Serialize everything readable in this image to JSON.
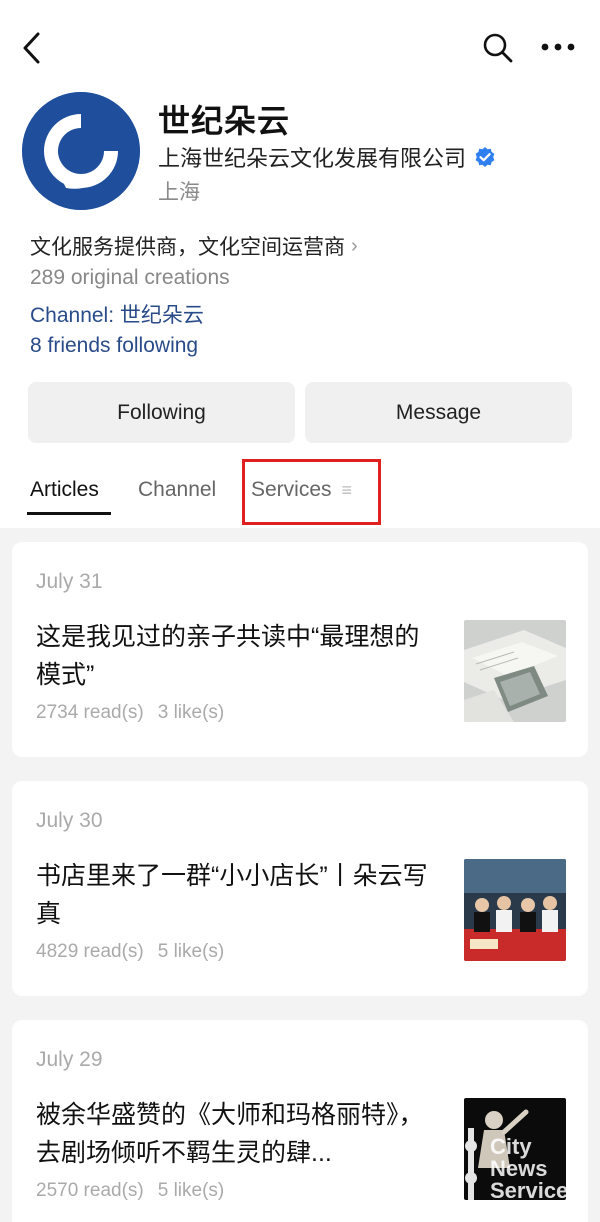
{
  "header": {
    "back_icon": "chevron-left-icon",
    "search_icon": "search-icon",
    "more_icon": "more-dots-icon"
  },
  "account": {
    "name": "世纪朵云",
    "company": "上海世纪朵云文化发展有限公司",
    "region": "上海",
    "description": "文化服务提供商，文化空间运营商",
    "original_creations": "289 original creations",
    "channel": "Channel: 世纪朵云",
    "friends_following": "8 friends following",
    "brand_color": "#1f4f9c",
    "verified_color": "#2f7ff0"
  },
  "actions": {
    "following_label": "Following",
    "message_label": "Message"
  },
  "tabs": {
    "articles": "Articles",
    "channel": "Channel",
    "services": "Services",
    "active": "Articles",
    "highlight_color": "#e02020"
  },
  "articles": [
    {
      "date": "July 31",
      "title": "这是我见过的亲子共读中“最理想的模式”",
      "reads": "2734 read(s)",
      "likes": "3 like(s)"
    },
    {
      "date": "July 30",
      "title": "书店里来了一群“小小店长”丨朵云写真",
      "reads": "4829 read(s)",
      "likes": "5 like(s)"
    },
    {
      "date": "July 29",
      "title": "被余华盛赞的《大师和玛格丽特》，去剧场倾听不羁生灵的肆...",
      "reads": "2570 read(s)",
      "likes": "5 like(s)",
      "thumb_watermark": "City News Service"
    }
  ]
}
